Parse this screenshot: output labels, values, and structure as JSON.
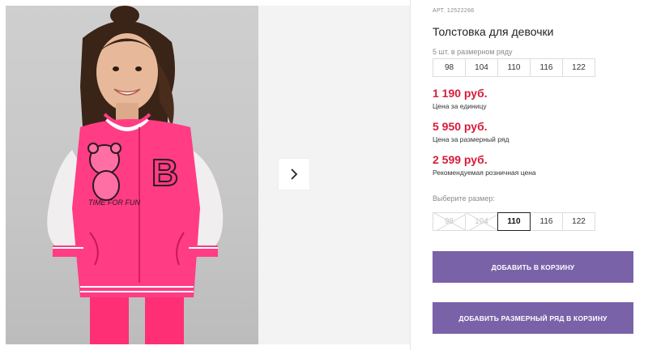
{
  "product": {
    "sku_label": "АРТ.",
    "sku": "12522266",
    "title": "Толстовка для девочки",
    "bear_patch_text": "TIME FOR FUN",
    "letter_patch": "B"
  },
  "size_range": {
    "label": "5 шт. в размерном ряду",
    "sizes": [
      "98",
      "104",
      "110",
      "116",
      "122"
    ]
  },
  "prices": [
    {
      "amount": "1 190 руб.",
      "note": "Цена за единицу"
    },
    {
      "amount": "5 950 руб.",
      "note": "Цена за размерный ряд"
    },
    {
      "amount": "2 599 руб.",
      "note": "Рекомендуемая розничная цена"
    }
  ],
  "size_picker": {
    "label": "Выберите размер:",
    "options": [
      {
        "label": "98",
        "state": "unavailable"
      },
      {
        "label": "104",
        "state": "unavailable"
      },
      {
        "label": "110",
        "state": "selected"
      },
      {
        "label": "116",
        "state": "available"
      },
      {
        "label": "122",
        "state": "available"
      }
    ]
  },
  "actions": {
    "add_to_cart": "ДОБАВИТЬ В КОРЗИНУ",
    "add_range_to_cart": "ДОБАВИТЬ РАЗМЕРНЫЙ РЯД В КОРЗИНУ"
  },
  "colors": {
    "price": "#d81b3a",
    "button": "#7a62a8",
    "jacket": "#ff3c84"
  },
  "icons": {
    "next": "chevron-right-icon"
  }
}
